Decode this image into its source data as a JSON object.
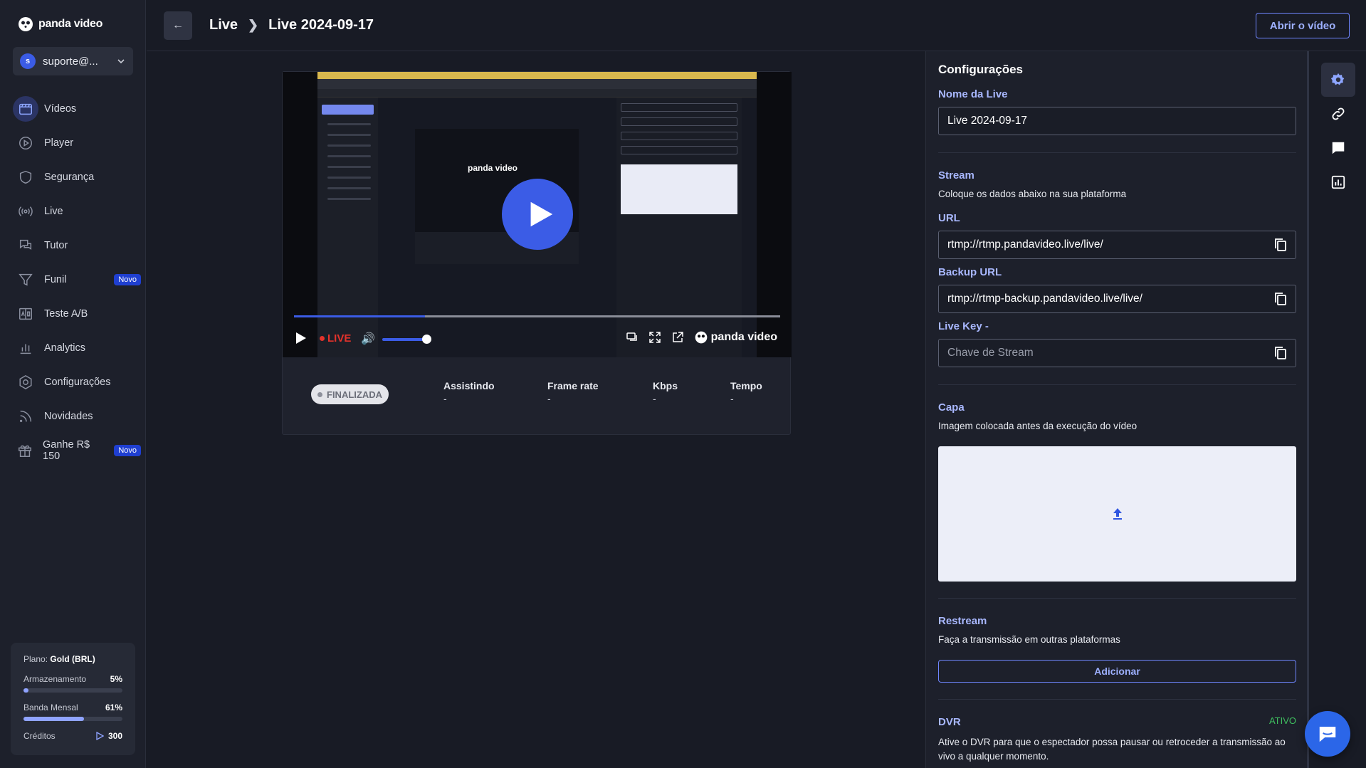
{
  "app": {
    "brand": "panda video"
  },
  "user": {
    "initial": "s",
    "name": "suporte@..."
  },
  "sidebar": {
    "items": [
      {
        "label": "Vídeos",
        "icon": "video-icon",
        "active": true
      },
      {
        "label": "Player",
        "icon": "play-circle-icon"
      },
      {
        "label": "Segurança",
        "icon": "shield-icon"
      },
      {
        "label": "Live",
        "icon": "broadcast-icon"
      },
      {
        "label": "Tutor",
        "icon": "chat-icon"
      },
      {
        "label": "Funil",
        "icon": "funnel-icon",
        "badge": "Novo"
      },
      {
        "label": "Teste A/B",
        "icon": "ab-test-icon"
      },
      {
        "label": "Analytics",
        "icon": "bar-chart-icon"
      },
      {
        "label": "Configurações",
        "icon": "settings-icon"
      },
      {
        "label": "Novidades",
        "icon": "rss-icon"
      },
      {
        "label": "Ganhe R$ 150",
        "icon": "gift-icon",
        "badge": "Novo"
      }
    ]
  },
  "plan": {
    "label": "Plano:",
    "name": "Gold (BRL)",
    "storage_label": "Armazenamento",
    "storage_value": "5%",
    "storage_fraction": 0.05,
    "bandwidth_label": "Banda Mensal",
    "bandwidth_value": "61%",
    "bandwidth_fraction": 0.61,
    "credits_label": "Créditos",
    "credits_value": "300"
  },
  "header": {
    "crumb1": "Live",
    "crumb2": "Live 2024-09-17",
    "open_button": "Abrir o vídeo"
  },
  "player": {
    "live_label": "LIVE",
    "logo": "panda video",
    "progress_fraction": 0.27
  },
  "stats": {
    "status": "FINALIZADA",
    "items": [
      {
        "label": "Assistindo",
        "value": "-"
      },
      {
        "label": "Frame rate",
        "value": "-"
      },
      {
        "label": "Kbps",
        "value": "-"
      },
      {
        "label": "Tempo",
        "value": "-"
      }
    ]
  },
  "settings": {
    "title": "Configurações",
    "name_label": "Nome da Live",
    "name_value": "Live 2024-09-17",
    "stream_label": "Stream",
    "stream_desc": "Coloque os dados abaixo na sua plataforma",
    "url_label": "URL",
    "url_value": "rtmp://rtmp.pandavideo.live/live/",
    "backup_label": "Backup URL",
    "backup_value": "rtmp://rtmp-backup.pandavideo.live/live/",
    "key_label": "Live Key -",
    "key_placeholder": "Chave de Stream",
    "cover_label": "Capa",
    "cover_desc": "Imagem colocada antes da execução do vídeo",
    "restream_label": "Restream",
    "restream_desc": "Faça a transmissão em outras plataformas",
    "add_button": "Adicionar",
    "dvr_label": "DVR",
    "dvr_status": "ATIVO",
    "dvr_desc": "Ative o DVR para que o espectador possa pausar ou retroceder a transmissão ao vivo a qualquer momento."
  },
  "colors": {
    "accent": "#3b5ce6",
    "label_blue": "#a9b8ff",
    "live_red": "#e4322b",
    "active_green": "#3fbf5f"
  }
}
